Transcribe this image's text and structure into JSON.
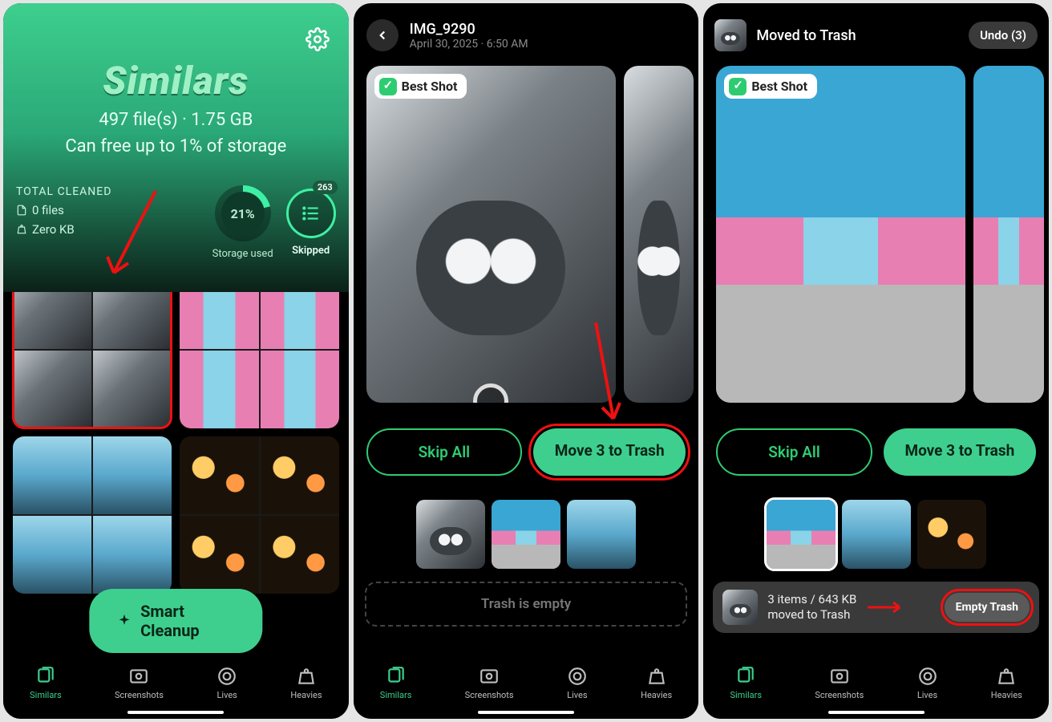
{
  "panel1": {
    "title": "Similars",
    "file_summary": "497 file(s) · 1.75 GB",
    "free_line": "Can free up to 1% of storage",
    "total_cleaned_label": "TOTAL CLEANED",
    "files_cleaned": "0 files",
    "size_cleaned": "Zero KB",
    "storage_pct": "21%",
    "storage_label": "Storage used",
    "skipped_label": "Skipped",
    "skipped_count": "263",
    "smart_cleanup": "Smart Cleanup"
  },
  "panel2": {
    "img_name": "IMG_9290",
    "img_meta": "April 30, 2025 · 6:50 AM",
    "best_shot": "Best Shot",
    "skip_all": "Skip All",
    "move_trash": "Move 3 to Trash",
    "trash_empty": "Trash is empty"
  },
  "panel3": {
    "moved_title": "Moved to Trash",
    "undo_label": "Undo (3)",
    "best_shot": "Best Shot",
    "skip_all": "Skip All",
    "move_trash": "Move 3 to Trash",
    "trash_summary_line1": "3 items / 643 KB",
    "trash_summary_line2": "moved to Trash",
    "empty_trash": "Empty Trash"
  },
  "tabs": {
    "similars": "Similars",
    "screenshots": "Screenshots",
    "lives": "Lives",
    "heavies": "Heavies"
  }
}
